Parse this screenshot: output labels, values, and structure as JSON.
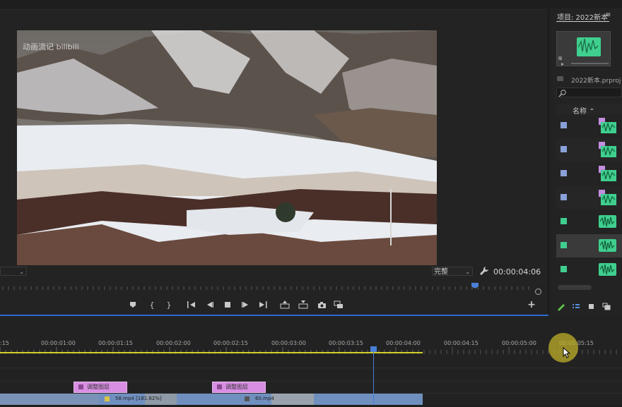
{
  "program_monitor": {
    "fit_value": "完整",
    "timecode": "00:00:04:06",
    "watermark": "动画流记 bilibili"
  },
  "transport": {
    "buttons": [
      "add-marker",
      "mark-in",
      "mark-out",
      "go-to-in",
      "step-back",
      "stop",
      "step-forward",
      "go-to-out",
      "lift",
      "extract",
      "export-frame",
      "compare-view",
      "add-button"
    ]
  },
  "project": {
    "title": "项目: 2022新本",
    "menu": "≡",
    "file": "2022新本.prproj",
    "column_name": "名称",
    "rows": [
      {
        "type": "sequence",
        "color": "#8aa0d8"
      },
      {
        "type": "sequence",
        "color": "#8aa0d8"
      },
      {
        "type": "sequence",
        "color": "#8aa0d8"
      },
      {
        "type": "sequence",
        "color": "#8aa0d8"
      },
      {
        "type": "audio",
        "color": "#3fcf8e"
      },
      {
        "type": "audio",
        "color": "#3fcf8e",
        "selected": true
      },
      {
        "type": "audio",
        "color": "#3fcf8e"
      }
    ]
  },
  "timeline": {
    "ticks": [
      ":15",
      "00:00:01:00",
      "00:00:01:15",
      "00:00:02:00",
      "00:00:02:15",
      "00:00:03:00",
      "00:00:03:15",
      "00:00:04:00",
      "00:00:04:15",
      "00:00:05:00",
      "00:00:05:15"
    ],
    "adjustment_clips": [
      "调整图层",
      "调整图层"
    ],
    "video_clips": [
      "58.mp4 [181.82%]",
      "60.mp4"
    ]
  },
  "colors": {
    "accent": "#2d6bd1",
    "workbar": "#cfcf2a",
    "clip_pink": "#d88ee3",
    "clip_blue": "#6f8fbf"
  }
}
